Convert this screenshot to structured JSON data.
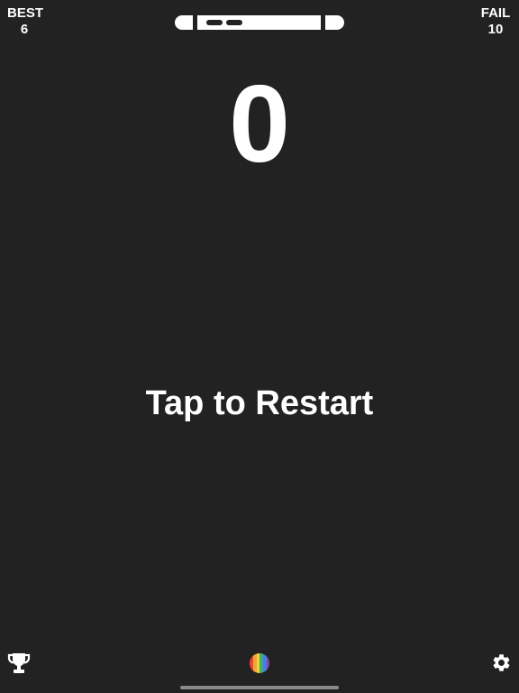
{
  "stats": {
    "best_label": "BEST",
    "best_value": "6",
    "fail_label": "FAIL",
    "fail_value": "10"
  },
  "game": {
    "score": "0",
    "restart_prompt": "Tap to Restart"
  },
  "icons": {
    "level_bar": "level-progress-bar-icon",
    "trophy": "trophy-icon",
    "color_theme": "rainbow-circle-icon",
    "settings": "gear-icon"
  },
  "colors": {
    "background": "#222222",
    "foreground": "#ffffff",
    "home_indicator": "#8a8a8a",
    "rainbow": [
      "#e8453c",
      "#f3a33a",
      "#f4d03f",
      "#4caf50",
      "#3b82f6",
      "#8e44ad"
    ]
  }
}
